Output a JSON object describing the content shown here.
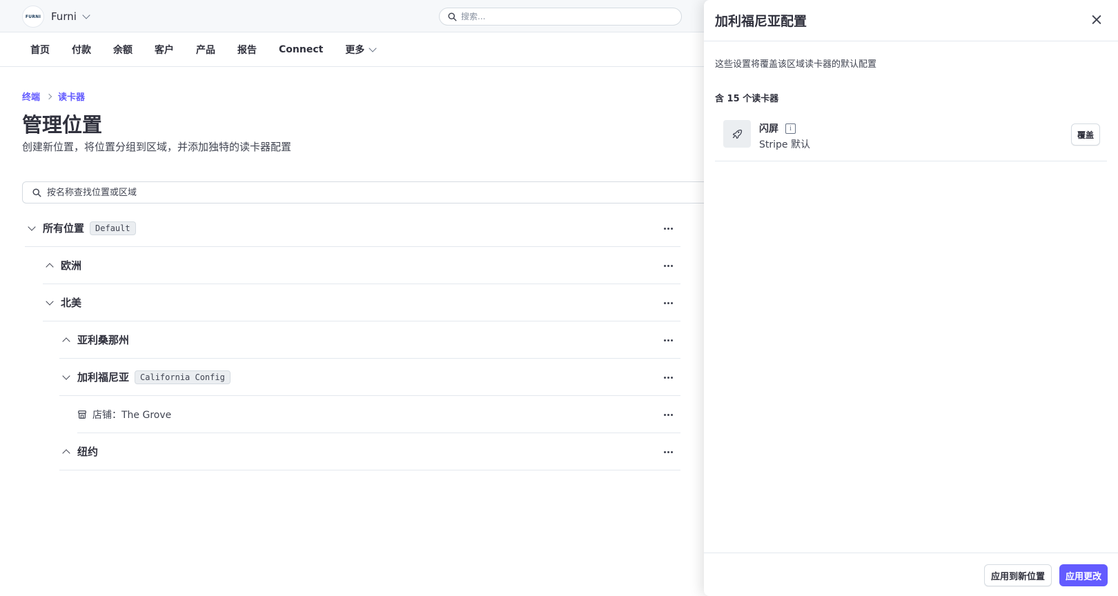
{
  "header": {
    "logo_text": "FURNI",
    "account_name": "Furni",
    "search_placeholder": "搜索..."
  },
  "nav": {
    "items": [
      "首页",
      "付款",
      "余额",
      "客户",
      "产品",
      "报告",
      "Connect",
      "更多"
    ]
  },
  "breadcrumb": [
    "终端",
    "读卡器"
  ],
  "page": {
    "title": "管理位置",
    "subtitle": "创建新位置，将位置分组到区域，并添加独特的读卡器配置",
    "search_placeholder": "按名称查找位置或区域"
  },
  "tree": [
    {
      "label": "所有位置",
      "badge": "Default",
      "state": "expanded"
    },
    {
      "label": "欧洲",
      "state": "collapsed"
    },
    {
      "label": "北美",
      "state": "expanded"
    },
    {
      "label": "亚利桑那州",
      "state": "collapsed"
    },
    {
      "label": "加利福尼亚",
      "badge": "California Config",
      "state": "expanded"
    },
    {
      "label": "店铺：The Grove",
      "type": "store"
    },
    {
      "label": "纽约",
      "state": "collapsed"
    }
  ],
  "panel": {
    "title": "加利福尼亚配置",
    "description": "这些设置将覆盖该区域读卡器的默认配置",
    "reader_count": "含 15 个读卡器",
    "setting": {
      "name": "闪屏",
      "value": "Stripe 默认",
      "override_label": "覆盖"
    },
    "apply_new_label": "应用到新位置",
    "apply_label": "应用更改"
  },
  "colors": {
    "accent": "#635bff",
    "topbar_bg": "#f6f8fa",
    "badge_bg": "#ebeef1"
  }
}
